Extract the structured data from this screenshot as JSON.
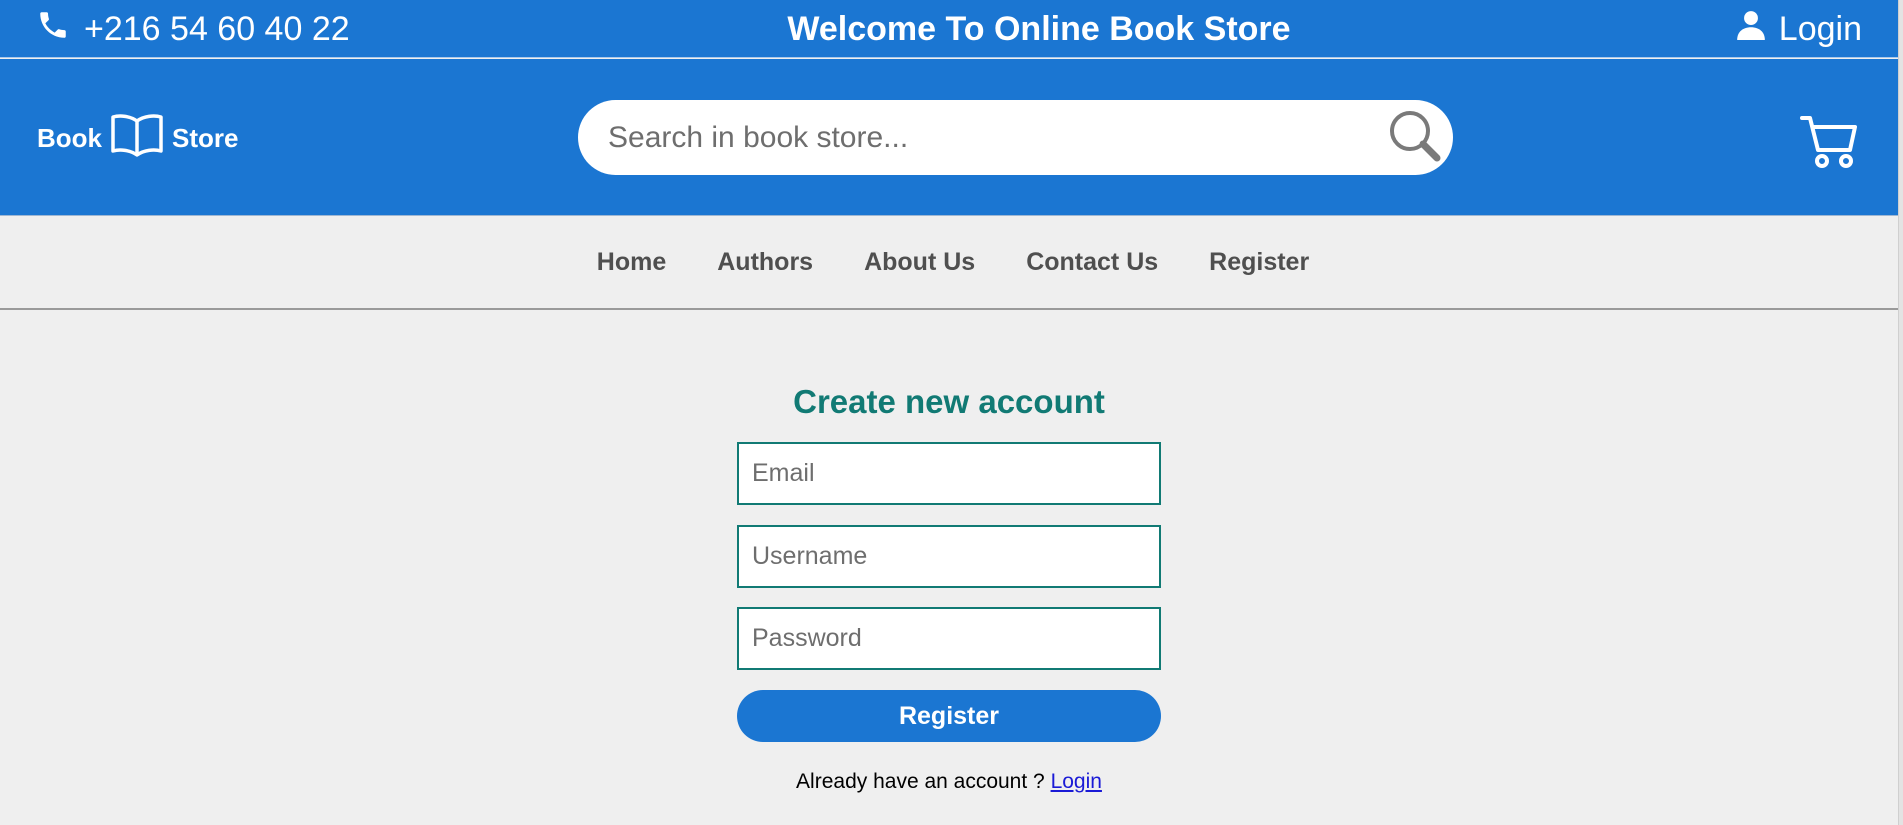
{
  "topbar": {
    "phone": "+216 54 60 40 22",
    "welcome": "Welcome To Online Book Store",
    "login_label": "Login"
  },
  "header": {
    "logo_left": "Book",
    "logo_right": "Store",
    "search_placeholder": "Search in book store..."
  },
  "nav": {
    "items": [
      {
        "label": "Home"
      },
      {
        "label": "Authors"
      },
      {
        "label": "About Us"
      },
      {
        "label": "Contact Us"
      },
      {
        "label": "Register"
      }
    ]
  },
  "form": {
    "title": "Create new account",
    "email_placeholder": "Email",
    "username_placeholder": "Username",
    "password_placeholder": "Password",
    "submit_label": "Register",
    "already_text": "Already have an account ?",
    "login_link": "Login"
  },
  "colors": {
    "brand": "#1b76d2",
    "accent_teal": "#117a74",
    "page_bg": "#efefef"
  },
  "icons": {
    "phone": "phone-icon",
    "user": "user-icon",
    "book": "open-book-icon",
    "search": "search-icon",
    "cart": "cart-icon"
  }
}
